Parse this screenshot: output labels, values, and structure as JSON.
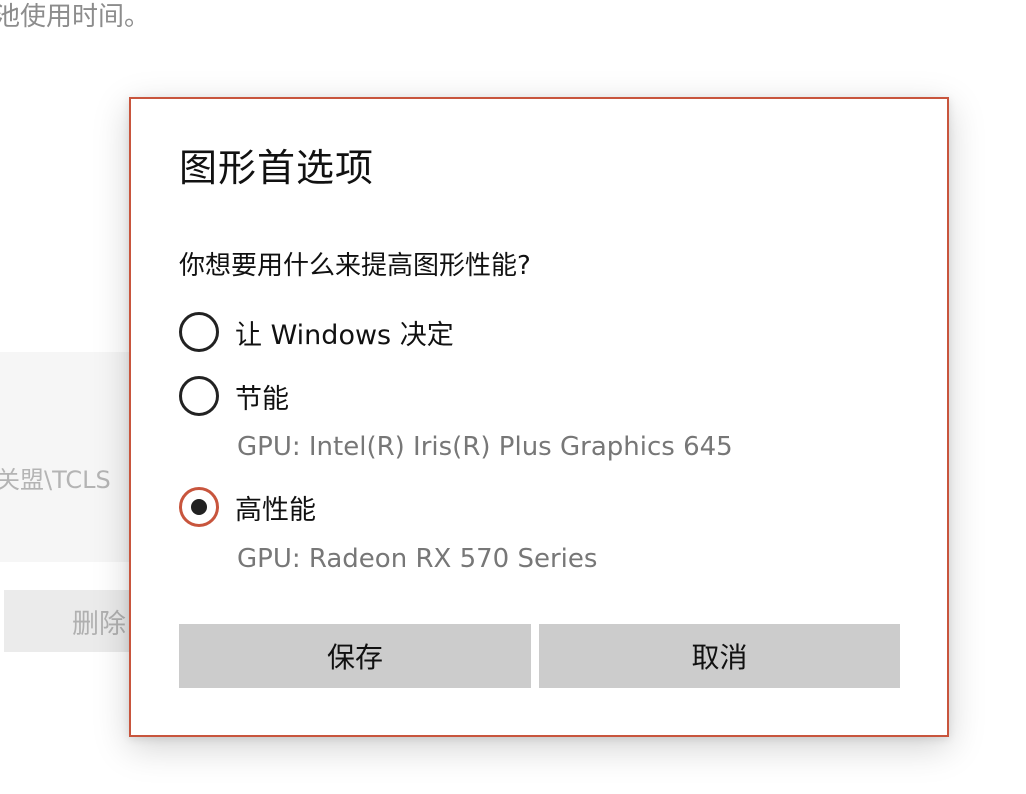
{
  "background": {
    "top_text": "池使用时间。",
    "path_text": "关盟\\TCLS",
    "delete_label": "删除"
  },
  "dialog": {
    "title": "图形首选项",
    "question": "你想要用什么来提高图形性能?",
    "options": [
      {
        "label": "让 Windows 决定",
        "gpu": "",
        "checked": false
      },
      {
        "label": "节能",
        "gpu": "GPU: Intel(R) Iris(R) Plus Graphics 645",
        "checked": false
      },
      {
        "label": "高性能",
        "gpu": "GPU: Radeon RX 570 Series",
        "checked": true
      }
    ],
    "save_label": "保存",
    "cancel_label": "取消",
    "accent_color": "#c8553d"
  }
}
